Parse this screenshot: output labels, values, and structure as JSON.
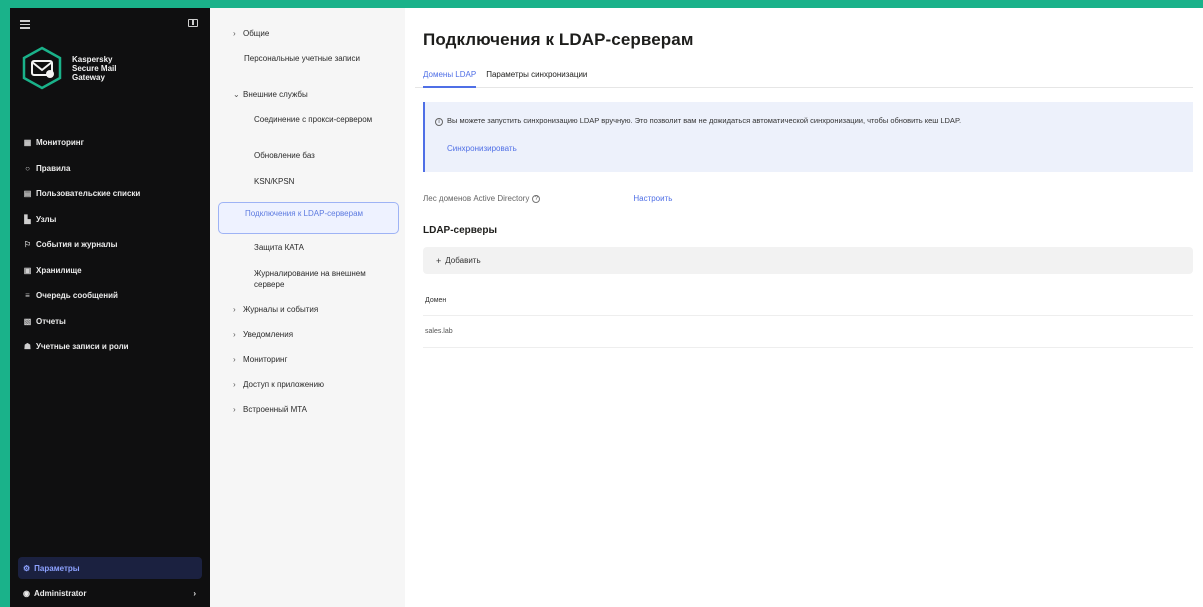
{
  "colors": {
    "frame": "#1ab28a",
    "sidebar": "#0f0f10",
    "accent": "#4f6fe6",
    "tree_bg": "#f6f6f6"
  },
  "sidebar": {
    "logo": {
      "line1": "Kaspersky",
      "line2": "Secure Mail",
      "line3": "Gateway"
    },
    "items": [
      {
        "icon": "grid-icon",
        "label": "Мониторинг"
      },
      {
        "icon": "circle-icon",
        "label": "Правила"
      },
      {
        "icon": "list-icon",
        "label": "Пользовательские списки"
      },
      {
        "icon": "nodes-icon",
        "label": "Узлы"
      },
      {
        "icon": "events-icon",
        "label": "События и журналы"
      },
      {
        "icon": "storage-icon",
        "label": "Хранилище"
      },
      {
        "icon": "queue-icon",
        "label": "Очередь сообщений"
      },
      {
        "icon": "report-icon",
        "label": "Отчеты"
      },
      {
        "icon": "users-icon",
        "label": "Учетные записи и роли"
      }
    ],
    "settings_label": "Параметры",
    "admin_label": "Administrator"
  },
  "tree": {
    "general": "Общие",
    "personal_accounts": "Персональные учетные записи",
    "external_services": "Внешние службы",
    "proxy": "Соединение с прокси-сервером",
    "db_update": "Обновление баз",
    "ksn": "KSN/KPSN",
    "ldap": "Подключения к LDAP-серверам",
    "kata": "Защита КАТА",
    "external_logging": "Журналирование на внешнем сервере",
    "logs_events": "Журналы и события",
    "notifications": "Уведомления",
    "monitoring": "Мониторинг",
    "app_access": "Доступ к приложению",
    "mta": "Встроенный MTA"
  },
  "main": {
    "title": "Подключения к LDAP-серверам",
    "tabs": [
      "Домены LDAP",
      "Параметры синхронизации"
    ],
    "info_text": "Вы можете запустить синхронизацию LDAP вручную. Это позволит вам не дожидаться автоматической синхронизации, чтобы обновить кеш LDAP.",
    "sync_link": "Синхронизировать",
    "forest_label": "Лес доменов Active Directory",
    "forest_link": "Настроить",
    "section_title": "LDAP-серверы",
    "add_label": "Добавить",
    "table_header": "Домен",
    "table_rows": [
      "sales.lab"
    ]
  }
}
